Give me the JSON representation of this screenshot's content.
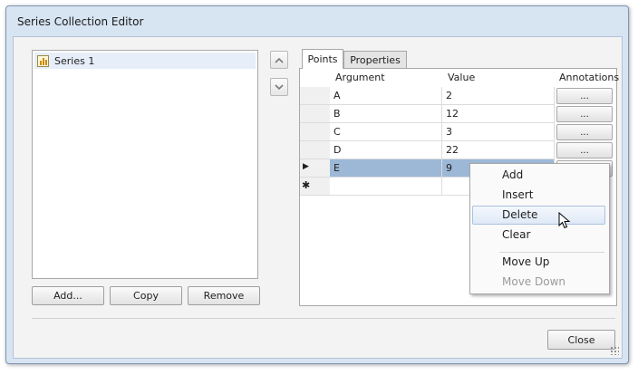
{
  "window": {
    "title": "Series Collection Editor"
  },
  "series": {
    "items": [
      {
        "label": "Series 1",
        "icon": "bar-chart-icon"
      }
    ]
  },
  "left_buttons": {
    "add": "Add...",
    "copy": "Copy",
    "remove": "Remove"
  },
  "reorder": {
    "up_icon": "chevron-up-icon",
    "down_icon": "chevron-down-icon"
  },
  "tabs": [
    {
      "label": "Points",
      "active": true
    },
    {
      "label": "Properties",
      "active": false
    }
  ],
  "grid": {
    "columns": {
      "argument": "Argument",
      "value": "Value",
      "annotations": "Annotations"
    },
    "ellipsis": "...",
    "rows": [
      {
        "argument": "A",
        "value": "2"
      },
      {
        "argument": "B",
        "value": "12"
      },
      {
        "argument": "C",
        "value": "3"
      },
      {
        "argument": "D",
        "value": "22"
      },
      {
        "argument": "E",
        "value": "9"
      }
    ],
    "current_row_glyph": "▶",
    "new_row_glyph": "✱",
    "selected_color": "#9db8d6"
  },
  "context_menu": {
    "items": [
      {
        "label": "Add"
      },
      {
        "label": "Insert"
      },
      {
        "label": "Delete"
      },
      {
        "label": "Clear"
      },
      {
        "label": "Move Up"
      },
      {
        "label": "Move Down"
      }
    ]
  },
  "footer": {
    "close": "Close"
  }
}
